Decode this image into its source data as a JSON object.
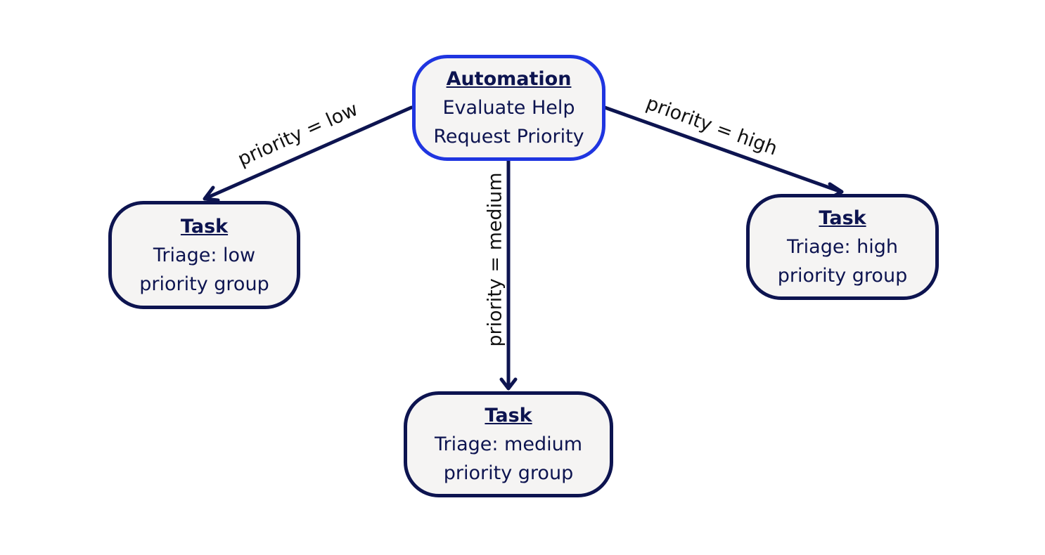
{
  "colors": {
    "edge": "#0d1450",
    "node_border": "#0d1450",
    "automation_border": "#1f35e0",
    "node_fill": "#f5f4f3"
  },
  "nodes": {
    "automation": {
      "type": "Automation",
      "line1": "Evaluate Help",
      "line2": "Request Priority"
    },
    "low": {
      "type": "Task",
      "line1": "Triage: low",
      "line2": "priority group"
    },
    "medium": {
      "type": "Task",
      "line1": "Triage: medium",
      "line2": "priority group"
    },
    "high": {
      "type": "Task",
      "line1": "Triage: high",
      "line2": "priority group"
    }
  },
  "edges": {
    "low": {
      "label": "priority = low"
    },
    "medium": {
      "label": "priority = medium"
    },
    "high": {
      "label": "priority = high"
    }
  }
}
